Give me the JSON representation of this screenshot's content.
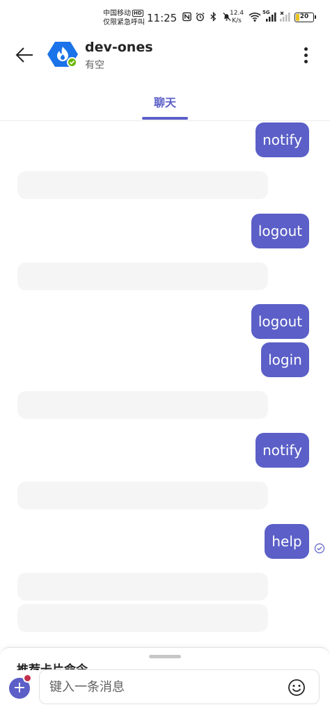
{
  "status_bar": {
    "carrier_line1": "中国移动",
    "carrier_hd": "HD",
    "carrier_line2": "仅限紧急呼叫",
    "time": "11:25",
    "net_speed_value": "12.4",
    "net_speed_unit": "K/s",
    "signal_label_5g": "5G",
    "battery": "20",
    "icons": [
      "nfc-icon",
      "alarm-icon",
      "bluetooth-icon",
      "mute-icon",
      "wifi-icon",
      "signal-icon",
      "signal-x-icon",
      "battery-icon"
    ]
  },
  "header": {
    "title": "dev-ones",
    "subtitle": "有空",
    "avatar_color": "#1a73e8",
    "presence_color": "#6bb700"
  },
  "tabs": [
    {
      "label": "聊天",
      "active": true
    }
  ],
  "messages": [
    {
      "direction": "out",
      "text": "notify"
    },
    {
      "direction": "in",
      "text": ""
    },
    {
      "direction": "out",
      "text": "logout"
    },
    {
      "direction": "in",
      "text": ""
    },
    {
      "direction": "out",
      "text": "logout"
    },
    {
      "direction": "out",
      "text": "login"
    },
    {
      "direction": "in",
      "text": ""
    },
    {
      "direction": "out",
      "text": "notify"
    },
    {
      "direction": "in",
      "text": ""
    },
    {
      "direction": "out",
      "text": "help"
    },
    {
      "direction": "in",
      "text": ""
    },
    {
      "direction": "in",
      "text": ""
    }
  ],
  "compose": {
    "placeholder": "键入一条消息",
    "peek_text": "推荐卡片命令"
  },
  "colors": {
    "accent": "#5b5fc7",
    "incoming_bubble": "#f5f5f5",
    "badge": "#c4314b"
  }
}
